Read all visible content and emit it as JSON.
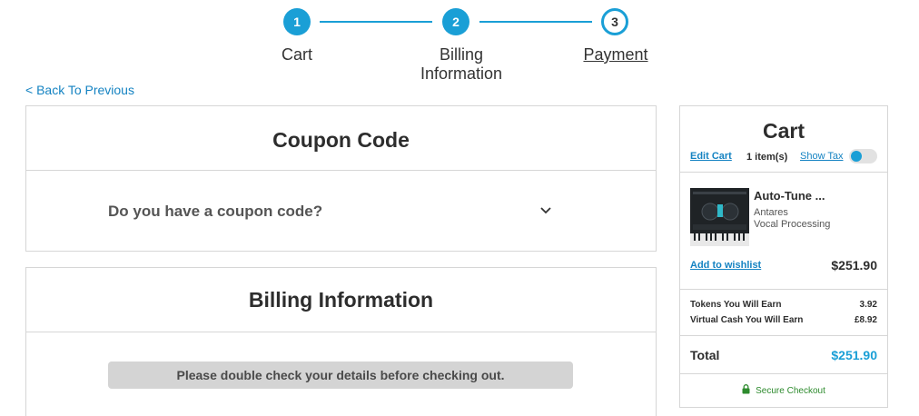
{
  "stepper": {
    "steps": [
      {
        "number": "1",
        "label": "Cart"
      },
      {
        "number": "2",
        "label_line1": "Billing",
        "label_line2": "Information"
      },
      {
        "number": "3",
        "label": "Payment"
      }
    ],
    "current_step": 3,
    "accent_color": "#1a9fd6"
  },
  "back_link": "< Back To Previous",
  "coupon": {
    "title": "Coupon Code",
    "question": "Do you have a coupon code?"
  },
  "billing": {
    "title": "Billing Information",
    "notice": "Please double check your details before checking out."
  },
  "cart": {
    "title": "Cart",
    "edit_label": "Edit Cart",
    "item_count": "1 item(s)",
    "show_tax_label": "Show Tax",
    "show_tax_on": true,
    "item": {
      "name": "Auto-Tune ...",
      "brand": "Antares",
      "category": "Vocal Processing",
      "wishlist_label": "Add to wishlist",
      "price": "$251.90"
    },
    "tokens_label": "Tokens You Will Earn",
    "tokens_value": "3.92",
    "cash_label": "Virtual Cash You Will Earn",
    "cash_value": "£8.92",
    "total_label": "Total",
    "total_value": "$251.90",
    "secure_label": "Secure Checkout"
  }
}
